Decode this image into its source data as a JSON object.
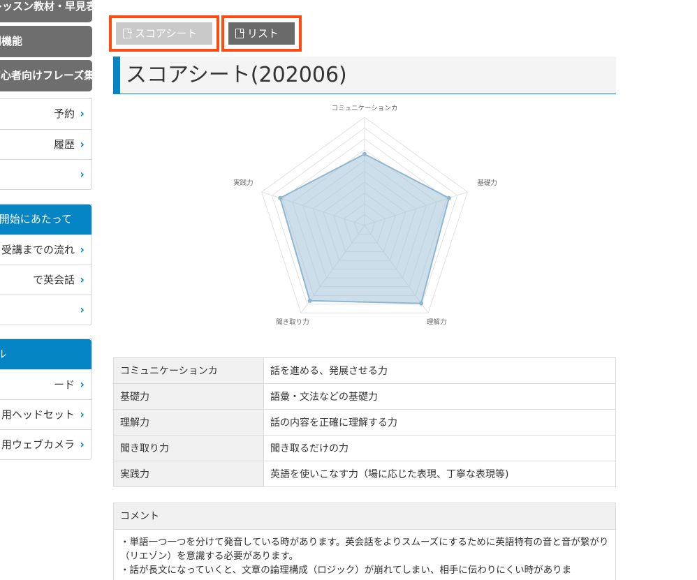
{
  "sidebar": {
    "top_buttons": [
      {
        "label": "レッスン教材・早見表"
      },
      {
        "label": "便利機能"
      },
      {
        "label": "初心者向けフレーズ集"
      }
    ],
    "group1": [
      {
        "label": "予約"
      },
      {
        "label": "履歴"
      },
      {
        "label": ""
      }
    ],
    "group2_title": "受講開始にあたって",
    "group2": [
      {
        "label": "受講までの流れ"
      },
      {
        "label": "で英会話"
      },
      {
        "label": ""
      }
    ],
    "group3_title": "ル",
    "group3": [
      {
        "label": "ード"
      },
      {
        "label": "用ヘッドセット"
      },
      {
        "label": "用ウェブカメラ"
      }
    ]
  },
  "buttons": {
    "score_label": "スコアシート",
    "list_label": "リスト"
  },
  "page_title": "スコアシート(202006)",
  "chart_data": {
    "type": "radar",
    "categories": [
      "コミュニケーションカ",
      "基礎力",
      "理解力",
      "聞き取り力",
      "実践力"
    ],
    "values": [
      6.6,
      8.2,
      8.9,
      8.6,
      8.2
    ],
    "rmax": 10,
    "rings": 10,
    "fill": "#a9c8dc",
    "stroke": "#8fb7d1"
  },
  "skills": [
    {
      "name": "コミュニケーションカ",
      "desc": "話を進める、発展させる力"
    },
    {
      "name": "基礎力",
      "desc": "語彙・文法などの基礎力"
    },
    {
      "name": "理解力",
      "desc": "話の内容を正確に理解する力"
    },
    {
      "name": "聞き取り力",
      "desc": "聞き取るだけの力"
    },
    {
      "name": "実践力",
      "desc": "英語を使いこなす力（場に応じた表現、丁寧な表現等)"
    }
  ],
  "comment": {
    "title": "コメント",
    "lines": [
      "・単語一つ一つを分けて発音している時があります。英会話をよりスムーズにするために英語特有の音と音が繋がり（リエゾン）を意識する必要があります。",
      "・話が長文になっていくと、文章の論理構成（ロジック）が崩れてしまい、相手に伝わりにくい時がありま"
    ]
  },
  "colors": {
    "accent": "#0685c4",
    "highlight": "#ff4a12",
    "button_gray": "#6e6e6e"
  }
}
